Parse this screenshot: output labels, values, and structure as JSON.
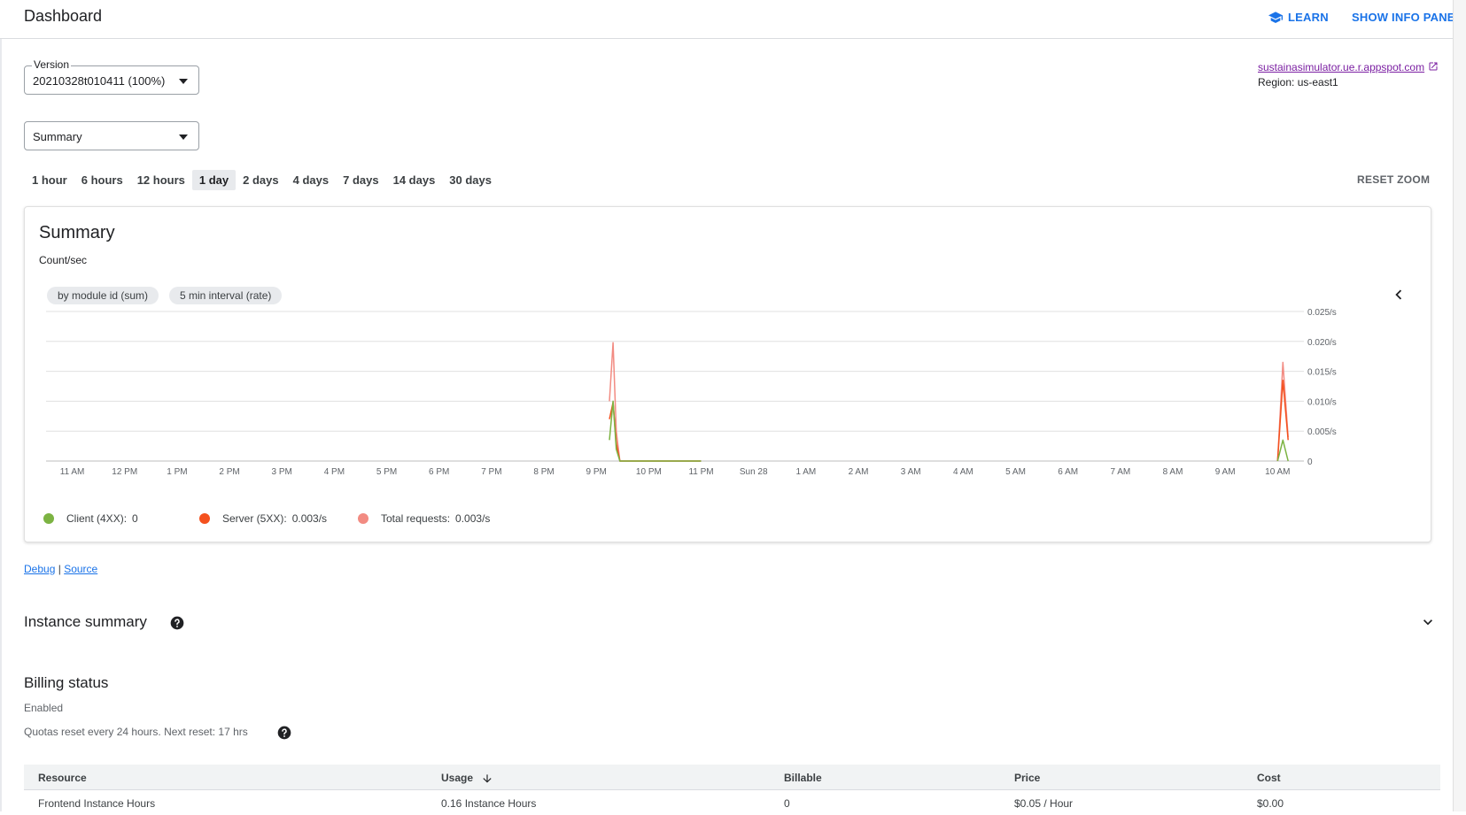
{
  "header": {
    "title": "Dashboard",
    "learn_label": "LEARN",
    "info_panel_label": "SHOW INFO PANEL"
  },
  "version_select": {
    "label": "Version",
    "value": "20210328t010411 (100%)"
  },
  "metric_select": {
    "value": "Summary"
  },
  "app": {
    "url": "sustainasimulator.ue.r.appspot.com",
    "region": "Region: us-east1"
  },
  "time_ranges": [
    "1 hour",
    "6 hours",
    "12 hours",
    "1 day",
    "2 days",
    "4 days",
    "7 days",
    "14 days",
    "30 days"
  ],
  "active_range": "1 day",
  "reset_zoom_label": "RESET ZOOM",
  "card": {
    "title": "Summary",
    "subtitle": "Count/sec",
    "chips": [
      "by module id (sum)",
      "5 min interval (rate)"
    ]
  },
  "chart_data": {
    "type": "line",
    "title": "Summary",
    "ylabel": "Count/sec",
    "x_tick_labels": [
      "11 AM",
      "12 PM",
      "1 PM",
      "2 PM",
      "3 PM",
      "4 PM",
      "5 PM",
      "6 PM",
      "7 PM",
      "8 PM",
      "9 PM",
      "10 PM",
      "11 PM",
      "Sun 28",
      "1 AM",
      "2 AM",
      "3 AM",
      "4 AM",
      "5 AM",
      "6 AM",
      "7 AM",
      "8 AM",
      "9 AM",
      "10 AM"
    ],
    "y_tick_labels": [
      "0",
      "0.005/s",
      "0.010/s",
      "0.015/s",
      "0.020/s",
      "0.025/s"
    ],
    "ylim": [
      0,
      0.025
    ],
    "xlim_hours": [
      10.5,
      34.4
    ],
    "grid": true,
    "series": [
      {
        "name": "Client (4XX)",
        "color": "#7cb342",
        "points": [
          [
            21.25,
            0.0035
          ],
          [
            21.32,
            0.01
          ],
          [
            21.38,
            0.002
          ],
          [
            21.45,
            0.0
          ],
          [
            23.0,
            0.0
          ],
          [
            34.0,
            0.0
          ],
          [
            34.1,
            0.0035
          ],
          [
            34.2,
            0.0
          ]
        ]
      },
      {
        "name": "Server (5XX)",
        "color": "#f4511e",
        "points": [
          [
            21.25,
            0.007
          ],
          [
            21.32,
            0.0098
          ],
          [
            21.38,
            0.003
          ],
          [
            21.45,
            0.0
          ],
          [
            23.0,
            0.0
          ],
          [
            34.0,
            0.0
          ],
          [
            34.1,
            0.0135
          ],
          [
            34.2,
            0.0035
          ]
        ]
      },
      {
        "name": "Total requests",
        "color": "#f28b82",
        "points": [
          [
            21.25,
            0.01
          ],
          [
            21.32,
            0.0198
          ],
          [
            21.38,
            0.005
          ],
          [
            21.45,
            0.0
          ],
          [
            23.0,
            0.0
          ],
          [
            34.0,
            0.0
          ],
          [
            34.1,
            0.0165
          ],
          [
            34.2,
            0.004
          ]
        ]
      }
    ]
  },
  "legend": [
    {
      "label": "Client (4XX):",
      "value": "0",
      "color": "#7cb342"
    },
    {
      "label": "Server (5XX):",
      "value": "0.003/s",
      "color": "#f4511e"
    },
    {
      "label": "Total requests:",
      "value": "0.003/s",
      "color": "#f28b82"
    }
  ],
  "links": {
    "debug": "Debug",
    "separator": "|",
    "source": "Source"
  },
  "instance_summary": {
    "title": "Instance summary"
  },
  "billing": {
    "title": "Billing status",
    "status": "Enabled",
    "quota_note": "Quotas reset every 24 hours. Next reset: 17 hrs"
  },
  "table": {
    "headers": [
      "Resource",
      "Usage",
      "Billable",
      "Price",
      "Cost"
    ],
    "rows": [
      [
        "Frontend Instance Hours",
        "0.16 Instance Hours",
        "0",
        "$0.05 / Hour",
        "$0.00"
      ]
    ]
  }
}
